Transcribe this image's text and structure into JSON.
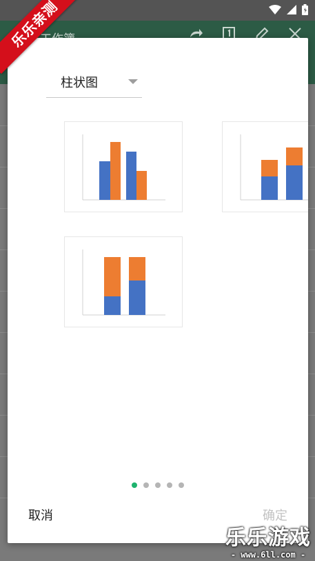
{
  "status_bar": {
    "icons": [
      "wifi-icon",
      "signal-icon",
      "battery-icon"
    ]
  },
  "app_bar": {
    "title": "工作簿",
    "icons": [
      "redo-icon",
      "page-icon",
      "edit-icon",
      "close-icon"
    ]
  },
  "badge": {
    "text": "乐乐亲测"
  },
  "dialog": {
    "dropdown": {
      "label": "柱状图"
    },
    "thumbnails": [
      {
        "type": "clustered-column",
        "colors": {
          "series_1": "#4472c4",
          "series_2": "#ed7d31"
        }
      },
      {
        "type": "stacked-column",
        "colors": {
          "series_1": "#4472c4",
          "series_2": "#ed7d31"
        }
      },
      {
        "type": "100-percent-stacked-column",
        "colors": {
          "series_1": "#4472c4",
          "series_2": "#ed7d31"
        }
      }
    ],
    "pager": {
      "count": 5,
      "active": 1,
      "active_color": "#1eb36e"
    },
    "cancel_label": "取消",
    "ok_label": "确定"
  },
  "watermark": {
    "main": "乐乐游戏",
    "sub": "- www.6ll.com -"
  }
}
